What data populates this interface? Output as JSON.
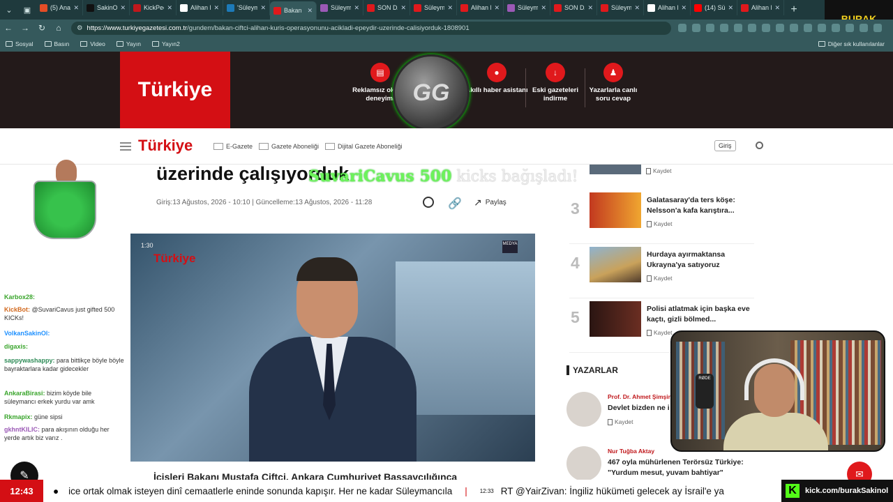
{
  "browser": {
    "tabs": [
      {
        "title": "(5) Anas",
        "color": "#e44d26",
        "active": false
      },
      {
        "title": "SakinOl",
        "color": "#111111",
        "active": false
      },
      {
        "title": "KickPeek",
        "color": "#c0181c",
        "active": false
      },
      {
        "title": "Alihan K",
        "color": "#ffffff",
        "active": false
      },
      {
        "title": "'Süleyma",
        "color": "#1d7ab8",
        "active": false
      },
      {
        "title": "Bakan",
        "color": "#e0191c",
        "active": true
      },
      {
        "title": "Süleyma",
        "color": "#9b59b6",
        "active": false
      },
      {
        "title": "SON DA",
        "color": "#e0191c",
        "active": false
      },
      {
        "title": "Süleyma",
        "color": "#e0191c",
        "active": false
      },
      {
        "title": "Alihan K",
        "color": "#e0191c",
        "active": false
      },
      {
        "title": "Süleyma",
        "color": "#9b59b6",
        "active": false
      },
      {
        "title": "SON DA",
        "color": "#e0191c",
        "active": false
      },
      {
        "title": "Süleyma",
        "color": "#e0191c",
        "active": false
      },
      {
        "title": "Alihan K",
        "color": "#ffffff",
        "active": false
      },
      {
        "title": "(14) Sül",
        "color": "#ff0000",
        "active": false
      },
      {
        "title": "Alihan K",
        "color": "#e0191c",
        "active": false
      }
    ],
    "url_host": "https://www.turkiyegazetesi.com.tr",
    "url_path": "/gundem/bakan-ciftci-alihan-kuris-operasyonunu-acikladi-epeydir-uzerinde-calisiyorduk-1808901",
    "bookmarks": [
      "Sosyal",
      "Basın",
      "Video",
      "Yayın",
      "Yayın2"
    ],
    "bookmarks_right": "Diğer sık kullanılanlar"
  },
  "streamer_badge": "BURAK",
  "site": {
    "logo": "Türkiye",
    "features": [
      {
        "label": "Reklamsız okuma deneyimi",
        "icon": "newspaper-icon"
      },
      {
        "label": "Akıllı haber asistanı",
        "icon": "chat-icon"
      },
      {
        "label": "Eski gazeteleri indirme",
        "icon": "download-icon"
      },
      {
        "label": "Yazarlarla canlı soru cevap",
        "icon": "users-icon"
      }
    ],
    "gg_badge": "GG",
    "nav": {
      "links": [
        "E-Gazete",
        "Gazete Aboneliği",
        "Dijital Gazete Aboneliği"
      ],
      "login": "Giriş"
    },
    "article": {
      "headline_fragment": "üzerinde çalışıyorduk",
      "donation_name": "SuvariCavus 500",
      "donation_text": " kicks bağışladı!",
      "dates": "Giriş:13 Ağustos, 2026 - 10:10 | Güncelleme:13 Ağustos, 2026 - 11:28",
      "share_label": "Paylaş",
      "video_duration": "1:30",
      "video_logo": "Türkiye",
      "video_badge": "MEDYA",
      "caption": "İçişleri Bakanı Mustafa Çiftçi, Ankara Cumhuriyet Başsavcılığınca"
    },
    "sidebar": {
      "save_label": "Kaydet",
      "items": [
        {
          "rank": "3",
          "title": "Galatasaray'da ters köşe: Nelsson'a kafa karıştıra..."
        },
        {
          "rank": "4",
          "title": "Hurdaya ayırmaktansa Ukrayna'ya satıyoruz"
        },
        {
          "rank": "5",
          "title": "Polisi atlatmak için başka eve kaçtı, gizli bölmed..."
        }
      ],
      "authors_header": "YAZARLAR",
      "authors": [
        {
          "name": "Prof. Dr. Ahmet Şimşir",
          "title": "Devlet bizden ne i"
        },
        {
          "name": "Nur Tuğba Aktay",
          "title": "467 oyla mühürlenen Terörsüz Türkiye: \"Yurdum mesut, yuvam bahtiyar\""
        }
      ]
    }
  },
  "chat": [
    {
      "user": "Karbox28:",
      "text": "",
      "color": "#3aa52c"
    },
    {
      "user": "KickBot:",
      "text": "@SuvariCavus just gifted 500 KICKs!",
      "color": "#d2691e"
    },
    {
      "user": "VolkanSakinOl:",
      "text": "",
      "color": "#1e90ff"
    },
    {
      "user": "digaxis:",
      "text": "",
      "color": "#3aa52c"
    },
    {
      "user": "sappywashappy:",
      "text": "para bittikçe böyle böyle bayraktarlara kadar gidecekler",
      "color": "#2e8b57"
    },
    {
      "user": "AnkaraBirasi:",
      "text": "bizim köyde bile süleymancı erkek yurdu var amk",
      "color": "#3aa52c"
    },
    {
      "user": "Rkmapix:",
      "text": "güne sipsi",
      "color": "#3aa52c"
    },
    {
      "user": "gkhntKILIC:",
      "text": "para akışının olduğu her yerde artık biz varız .",
      "color": "#9b59b6"
    }
  ],
  "webcam": {
    "mic_label": "RØDE"
  },
  "ticker": {
    "time": "12:43",
    "text1": "ice ortak olmak isteyen dinî cemaatlerle eninde sonunda kapışır. Her ne kadar Süleymancıla",
    "time2": "12:33",
    "text2": "RT @YairZivan: İngiliz hükümeti gelecek ay İsrail'e ya",
    "kick_url": "kick.com/burakSakinol"
  }
}
